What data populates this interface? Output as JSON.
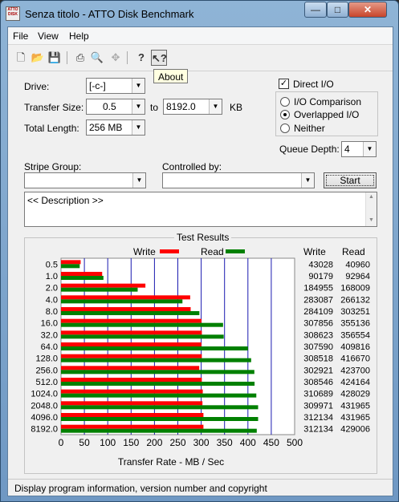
{
  "window": {
    "title": "Senza titolo - ATTO Disk Benchmark",
    "icon_text": "ATTO DISK",
    "controls": {
      "minimize": "—",
      "maximize": "□",
      "close": "✕"
    }
  },
  "menu": [
    "File",
    "View",
    "Help"
  ],
  "toolbar": {
    "icons": [
      "new-file-icon",
      "open-folder-icon",
      "save-icon",
      "print-icon",
      "print-preview-icon",
      "move-icon",
      "help-icon",
      "context-help-icon"
    ],
    "tooltip": "About"
  },
  "settings": {
    "drive_label": "Drive:",
    "drive_value": "[-c-]",
    "transfer_size_label": "Transfer Size:",
    "transfer_from": "0.5",
    "transfer_to_label": "to",
    "transfer_to": "8192.0",
    "transfer_unit": "KB",
    "total_length_label": "Total Length:",
    "total_length_value": "256 MB",
    "direct_io_label": "Direct I/O",
    "direct_io_checked": true,
    "io_options": [
      "I/O Comparison",
      "Overlapped I/O",
      "Neither"
    ],
    "io_selected": "Overlapped I/O",
    "queue_depth_label": "Queue Depth:",
    "queue_depth_value": "4",
    "stripe_group_label": "Stripe Group:",
    "controlled_by_label": "Controlled by:",
    "start_label": "Start",
    "description": "<< Description >>"
  },
  "results": {
    "title": "Test Results",
    "legend_write": "Write",
    "legend_read": "Read",
    "col_write": "Write",
    "col_read": "Read",
    "write_color": "#ff0000",
    "read_color": "#008000"
  },
  "chart_data": {
    "type": "bar",
    "orientation": "horizontal",
    "categories": [
      "0.5",
      "1.0",
      "2.0",
      "4.0",
      "8.0",
      "16.0",
      "32.0",
      "64.0",
      "128.0",
      "256.0",
      "512.0",
      "1024.0",
      "2048.0",
      "4096.0",
      "8192.0"
    ],
    "series": [
      {
        "name": "Write",
        "values": [
          43028,
          90179,
          184955,
          283087,
          284109,
          307856,
          308623,
          307590,
          308518,
          302921,
          308546,
          310689,
          309971,
          312134,
          312134
        ]
      },
      {
        "name": "Read",
        "values": [
          40960,
          92964,
          168009,
          266132,
          303251,
          355136,
          356554,
          409816,
          416670,
          423700,
          424164,
          428029,
          431965,
          431965,
          429006
        ]
      }
    ],
    "xlabel": "Transfer Rate - MB / Sec",
    "xticks": [
      "0",
      "50",
      "100",
      "150",
      "200",
      "250",
      "300",
      "350",
      "400",
      "450",
      "500"
    ],
    "xlim": [
      0,
      500
    ],
    "grid": true
  },
  "status": "Display program information, version number and copyright"
}
